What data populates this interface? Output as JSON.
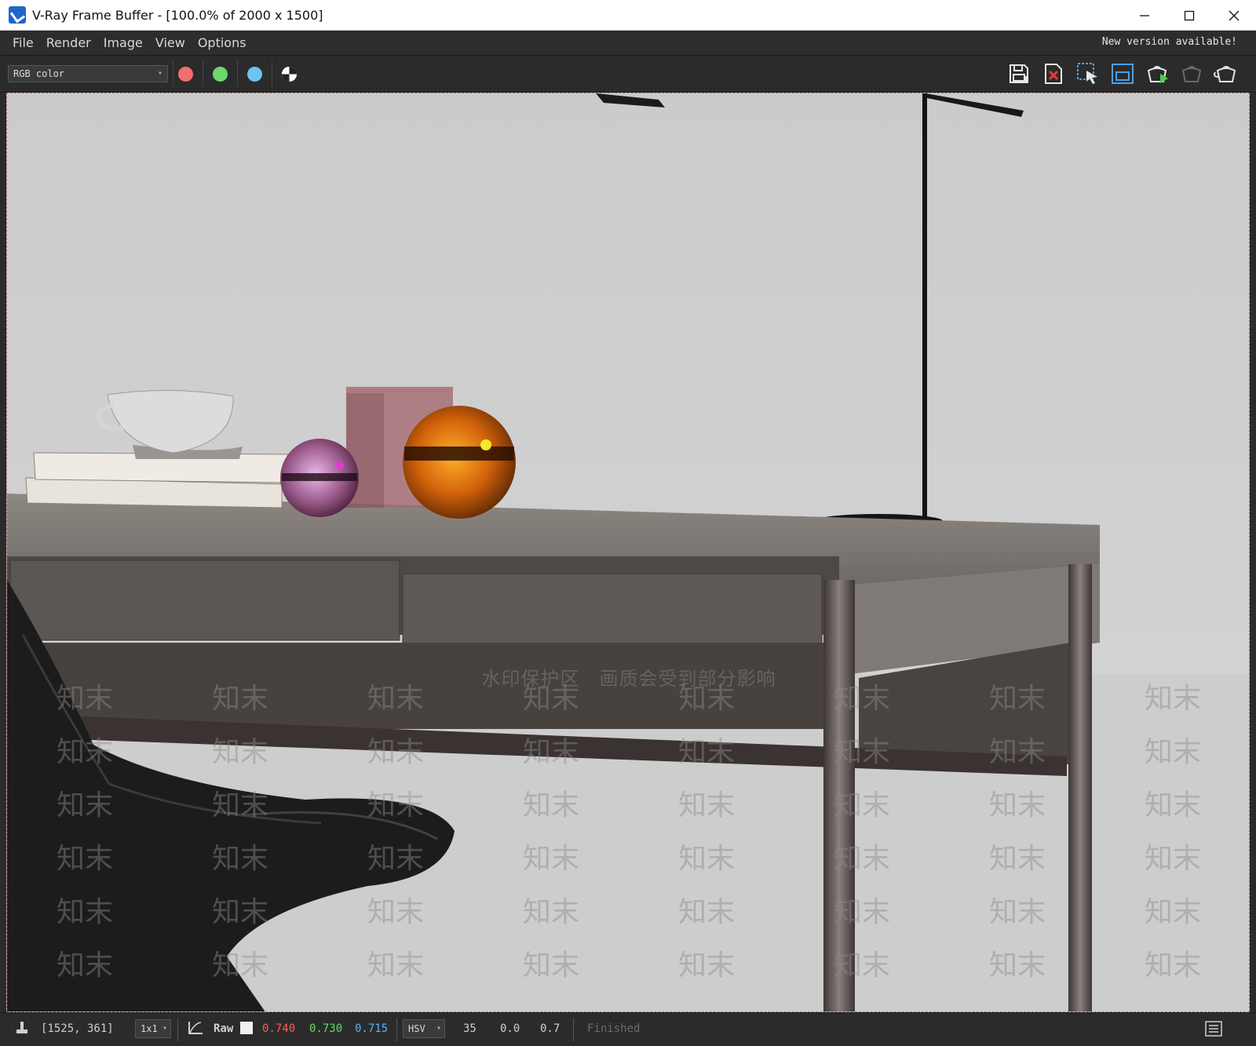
{
  "window": {
    "title": "V-Ray Frame Buffer - [100.0% of 2000 x 1500]",
    "minimize_icon": "minimize-icon",
    "maximize_icon": "maximize-icon",
    "close_icon": "close-icon"
  },
  "menu": {
    "items": [
      "File",
      "Render",
      "Image",
      "View",
      "Options"
    ],
    "notice": "New version available!"
  },
  "toolbar": {
    "channel": "RGB color",
    "channel_buttons": [
      {
        "name": "red-channel",
        "color": "#f07070"
      },
      {
        "name": "green-channel",
        "color": "#6cd86c"
      },
      {
        "name": "blue-channel",
        "color": "#6cc4f0"
      },
      {
        "name": "alpha-channel",
        "icon": "alpha-channel-icon"
      }
    ],
    "tools": [
      "save-image-icon",
      "clear-image-icon",
      "track-mouse-icon",
      "region-render-icon",
      "render-interactive-icon",
      "render-last-icon",
      "render-icon"
    ]
  },
  "watermark": {
    "banner": "水印保护区　画质会受到部分影响",
    "text": "知末"
  },
  "status": {
    "coords": "[1525, 361]",
    "zoom": "1x1",
    "mode": "Raw",
    "r": "0.740",
    "g": "0.730",
    "b": "0.715",
    "color_space": "HSV",
    "h": "35",
    "s": "0.0",
    "v": "0.7",
    "state": "Finished"
  }
}
